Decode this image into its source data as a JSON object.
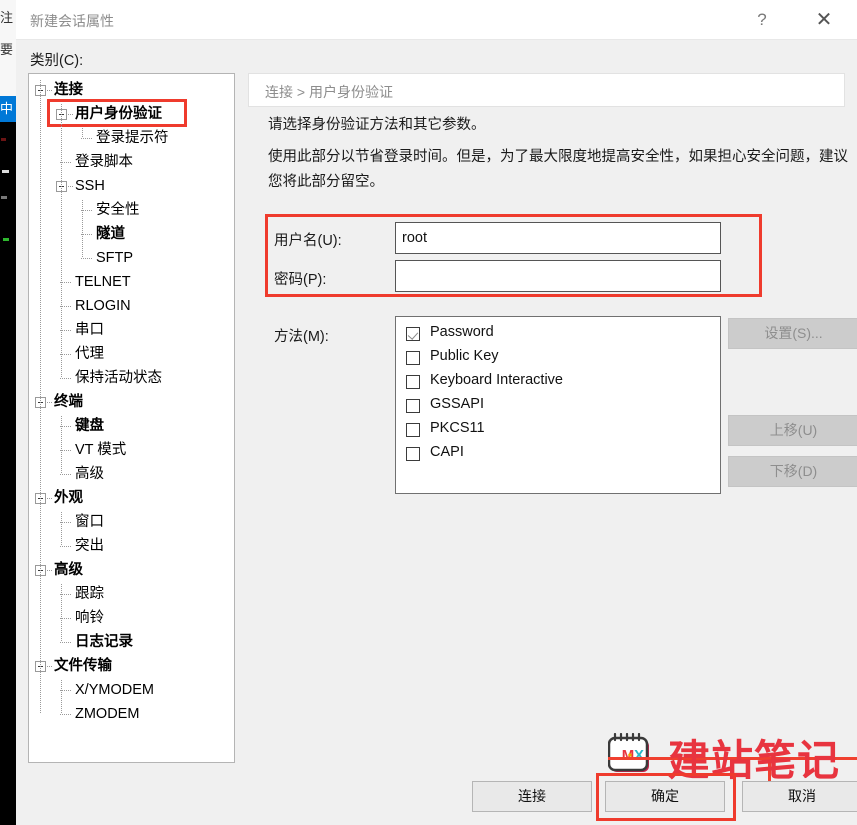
{
  "window": {
    "title": "新建会话属性",
    "help_icon": "?",
    "close_icon": "✕"
  },
  "category": {
    "label": "类别(C):",
    "tree": [
      {
        "label": "连接",
        "level": 0,
        "bold": true,
        "expander": true,
        "highlighted": false
      },
      {
        "label": "用户身份验证",
        "level": 1,
        "bold": true,
        "expander": true,
        "highlighted": true
      },
      {
        "label": "登录提示符",
        "level": 2,
        "bold": false,
        "expander": false,
        "highlighted": false
      },
      {
        "label": "登录脚本",
        "level": 1,
        "bold": false,
        "expander": false,
        "highlighted": false
      },
      {
        "label": "SSH",
        "level": 1,
        "bold": false,
        "expander": true,
        "highlighted": false
      },
      {
        "label": "安全性",
        "level": 2,
        "bold": false,
        "expander": false,
        "highlighted": false
      },
      {
        "label": "隧道",
        "level": 2,
        "bold": true,
        "expander": false,
        "highlighted": false
      },
      {
        "label": "SFTP",
        "level": 2,
        "bold": false,
        "expander": false,
        "highlighted": false
      },
      {
        "label": "TELNET",
        "level": 1,
        "bold": false,
        "expander": false,
        "highlighted": false
      },
      {
        "label": "RLOGIN",
        "level": 1,
        "bold": false,
        "expander": false,
        "highlighted": false
      },
      {
        "label": "串口",
        "level": 1,
        "bold": false,
        "expander": false,
        "highlighted": false
      },
      {
        "label": "代理",
        "level": 1,
        "bold": false,
        "expander": false,
        "highlighted": false
      },
      {
        "label": "保持活动状态",
        "level": 1,
        "bold": false,
        "expander": false,
        "highlighted": false
      },
      {
        "label": "终端",
        "level": 0,
        "bold": true,
        "expander": true,
        "highlighted": false
      },
      {
        "label": "键盘",
        "level": 1,
        "bold": true,
        "expander": false,
        "highlighted": false
      },
      {
        "label": "VT 模式",
        "level": 1,
        "bold": false,
        "expander": false,
        "highlighted": false
      },
      {
        "label": "高级",
        "level": 1,
        "bold": false,
        "expander": false,
        "highlighted": false
      },
      {
        "label": "外观",
        "level": 0,
        "bold": true,
        "expander": true,
        "highlighted": false
      },
      {
        "label": "窗口",
        "level": 1,
        "bold": false,
        "expander": false,
        "highlighted": false
      },
      {
        "label": "突出",
        "level": 1,
        "bold": false,
        "expander": false,
        "highlighted": false
      },
      {
        "label": "高级",
        "level": 0,
        "bold": true,
        "expander": true,
        "highlighted": false
      },
      {
        "label": "跟踪",
        "level": 1,
        "bold": false,
        "expander": false,
        "highlighted": false
      },
      {
        "label": "响铃",
        "level": 1,
        "bold": false,
        "expander": false,
        "highlighted": false
      },
      {
        "label": "日志记录",
        "level": 1,
        "bold": true,
        "expander": false,
        "highlighted": false
      },
      {
        "label": "文件传输",
        "level": 0,
        "bold": true,
        "expander": true,
        "highlighted": false
      },
      {
        "label": "X/YMODEM",
        "level": 1,
        "bold": false,
        "expander": false,
        "highlighted": false
      },
      {
        "label": "ZMODEM",
        "level": 1,
        "bold": false,
        "expander": false,
        "highlighted": false
      }
    ]
  },
  "content": {
    "breadcrumb": "连接 > 用户身份验证",
    "description_line1": "请选择身份验证方法和其它参数。",
    "description_line2": "使用此部分以节省登录时间。但是，为了最大限度地提高安全性，如果担心安全问题，建议您将此部分留空。"
  },
  "credentials": {
    "username_label": "用户名(U):",
    "username_value": "root",
    "username_placeholder": "",
    "password_label": "密码(P):",
    "password_value": "",
    "password_placeholder": ""
  },
  "methods": {
    "label": "方法(M):",
    "items": [
      {
        "label": "Password",
        "checked": true
      },
      {
        "label": "Public Key",
        "checked": false
      },
      {
        "label": "Keyboard Interactive",
        "checked": false
      },
      {
        "label": "GSSAPI",
        "checked": false
      },
      {
        "label": "PKCS11",
        "checked": false
      },
      {
        "label": "CAPI",
        "checked": false
      }
    ]
  },
  "side_buttons": {
    "settings": "设置(S)...",
    "move_up": "上移(U)",
    "move_down": "下移(D)"
  },
  "bottom_buttons": {
    "connect": "连接",
    "ok": "确定",
    "cancel": "取消"
  },
  "watermark": {
    "text": "建站笔记",
    "logo_text": "M·X"
  },
  "backdrop": {
    "line1": "注",
    "line2": "要",
    "selected": "中"
  },
  "colors": {
    "highlight_red": "#ef3b2d",
    "dialog_bg": "#f0f0f0",
    "selection_blue": "#0078d7",
    "watermark_red": "#e8343f"
  }
}
